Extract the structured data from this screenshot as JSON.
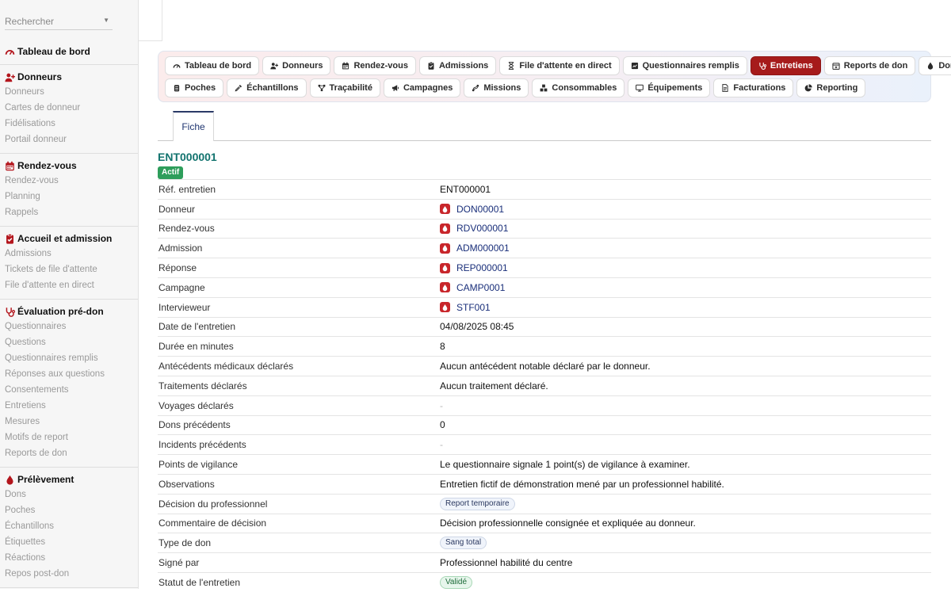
{
  "sidebar": {
    "search": {
      "placeholder": "Rechercher"
    },
    "sections": [
      {
        "title": "Tableau de bord",
        "icon": "gauge-icon",
        "items": []
      },
      {
        "title": "Donneurs",
        "icon": "user-plus-icon",
        "items": [
          "Donneurs",
          "Cartes de donneur",
          "Fidélisations",
          "Portail donneur"
        ]
      },
      {
        "title": "Rendez-vous",
        "icon": "calendar-icon",
        "items": [
          "Rendez-vous",
          "Planning",
          "Rappels"
        ]
      },
      {
        "title": "Accueil et admission",
        "icon": "clipboard-check-icon",
        "items": [
          "Admissions",
          "Tickets de file d'attente",
          "File d'attente en direct"
        ]
      },
      {
        "title": "Évaluation pré-don",
        "icon": "stethoscope-icon",
        "items": [
          "Questionnaires",
          "Questions",
          "Questionnaires remplis",
          "Réponses aux questions",
          "Consentements",
          "Entretiens",
          "Mesures",
          "Motifs de report",
          "Reports de don"
        ]
      },
      {
        "title": "Prélèvement",
        "icon": "drop-icon",
        "items": [
          "Dons",
          "Poches",
          "Échantillons",
          "Étiquettes",
          "Réactions",
          "Repos post-don"
        ]
      }
    ]
  },
  "tabs": {
    "row1": [
      {
        "label": "Tableau de bord",
        "icon": "gauge-icon",
        "active": false
      },
      {
        "label": "Donneurs",
        "icon": "user-plus-icon",
        "active": false
      },
      {
        "label": "Rendez-vous",
        "icon": "calendar-icon",
        "active": false
      },
      {
        "label": "Admissions",
        "icon": "clipboard-check-icon",
        "active": false
      },
      {
        "label": "File d'attente en direct",
        "icon": "hourglass-icon",
        "active": false
      },
      {
        "label": "Questionnaires remplis",
        "icon": "form-icon",
        "active": false
      },
      {
        "label": "Entretiens",
        "icon": "stethoscope-icon",
        "active": true
      },
      {
        "label": "Reports de don",
        "icon": "calendar-x-icon",
        "active": false
      },
      {
        "label": "Dons",
        "icon": "drop-icon",
        "active": false
      }
    ],
    "row2": [
      {
        "label": "Poches",
        "icon": "bag-icon",
        "active": false
      },
      {
        "label": "Échantillons",
        "icon": "pipette-icon",
        "active": false
      },
      {
        "label": "Traçabilité",
        "icon": "network-icon",
        "active": false
      },
      {
        "label": "Campagnes",
        "icon": "megaphone-icon",
        "active": false
      },
      {
        "label": "Missions",
        "icon": "route-icon",
        "active": false
      },
      {
        "label": "Consommables",
        "icon": "boxes-icon",
        "active": false
      },
      {
        "label": "Équipements",
        "icon": "monitor-icon",
        "active": false
      },
      {
        "label": "Facturations",
        "icon": "invoice-icon",
        "active": false
      },
      {
        "label": "Reporting",
        "icon": "pie-chart-icon",
        "active": false
      }
    ]
  },
  "subtab": {
    "label": "Fiche"
  },
  "record": {
    "title": "ENT000001",
    "status": "Actif",
    "fields": [
      {
        "label": "Réf. entretien",
        "value": "ENT000001",
        "kind": "text"
      },
      {
        "label": "Donneur",
        "value": "DON00001",
        "kind": "link"
      },
      {
        "label": "Rendez-vous",
        "value": "RDV000001",
        "kind": "link"
      },
      {
        "label": "Admission",
        "value": "ADM000001",
        "kind": "link"
      },
      {
        "label": "Réponse",
        "value": "REP000001",
        "kind": "link"
      },
      {
        "label": "Campagne",
        "value": "CAMP0001",
        "kind": "link"
      },
      {
        "label": "Intervieweur",
        "value": "STF001",
        "kind": "link"
      },
      {
        "label": "Date de l'entretien",
        "value": "04/08/2025 08:45",
        "kind": "text"
      },
      {
        "label": "Durée en minutes",
        "value": "8",
        "kind": "text"
      },
      {
        "label": "Antécédents médicaux déclarés",
        "value": "Aucun antécédent notable déclaré par le donneur.",
        "kind": "text"
      },
      {
        "label": "Traitements déclarés",
        "value": "Aucun traitement déclaré.",
        "kind": "text"
      },
      {
        "label": "Voyages déclarés",
        "value": "-",
        "kind": "empty"
      },
      {
        "label": "Dons précédents",
        "value": "0",
        "kind": "text"
      },
      {
        "label": "Incidents précédents",
        "value": "-",
        "kind": "empty"
      },
      {
        "label": "Points de vigilance",
        "value": "Le questionnaire signale 1 point(s) de vigilance à examiner.",
        "kind": "text"
      },
      {
        "label": "Observations",
        "value": "Entretien fictif de démonstration mené par un professionnel habilité.",
        "kind": "text"
      },
      {
        "label": "Décision du professionnel",
        "value": "Report temporaire",
        "kind": "badge"
      },
      {
        "label": "Commentaire de décision",
        "value": "Décision professionnelle consignée et expliquée au donneur.",
        "kind": "text"
      },
      {
        "label": "Type de don",
        "value": "Sang total",
        "kind": "badge"
      },
      {
        "label": "Signé par",
        "value": "Professionnel habilité du centre",
        "kind": "text"
      },
      {
        "label": "Statut de l'entretien",
        "value": "Validé",
        "kind": "badge-green"
      }
    ]
  },
  "colors": {
    "accent": "#a61b1b",
    "title": "#12736e",
    "link": "#1a2f7a",
    "status_active": "#2e9e5b"
  }
}
